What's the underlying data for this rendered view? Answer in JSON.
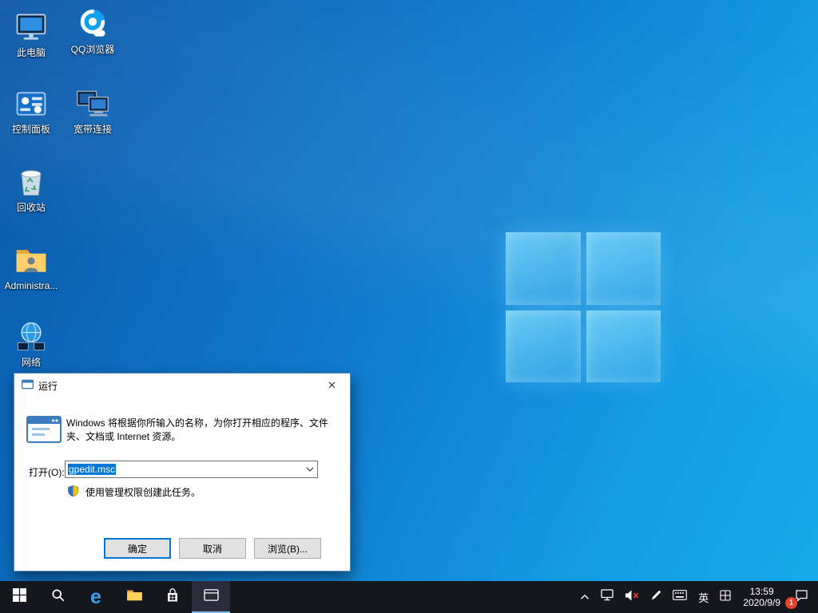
{
  "desktop": {
    "icons": [
      {
        "label": "此电脑"
      },
      {
        "label": "QQ浏览器"
      },
      {
        "label": "控制面板"
      },
      {
        "label": "宽带连接"
      },
      {
        "label": "回收站"
      },
      {
        "label": "Administra..."
      },
      {
        "label": "网络"
      }
    ]
  },
  "run_dialog": {
    "title": "运行",
    "close_glyph": "✕",
    "description": "Windows 将根据你所输入的名称，为你打开相应的程序、文件夹、文档或 Internet 资源。",
    "open_label": "打开(O):",
    "input_value": "gpedit.msc",
    "admin_note": "使用管理权限创建此任务。",
    "ok_label": "确定",
    "cancel_label": "取消",
    "browse_label": "浏览(B)..."
  },
  "taskbar": {
    "edge_glyph": "e",
    "ime_label": "英",
    "clock": {
      "time": "13:59",
      "date": "2020/9/9"
    },
    "notification_count": "1"
  }
}
